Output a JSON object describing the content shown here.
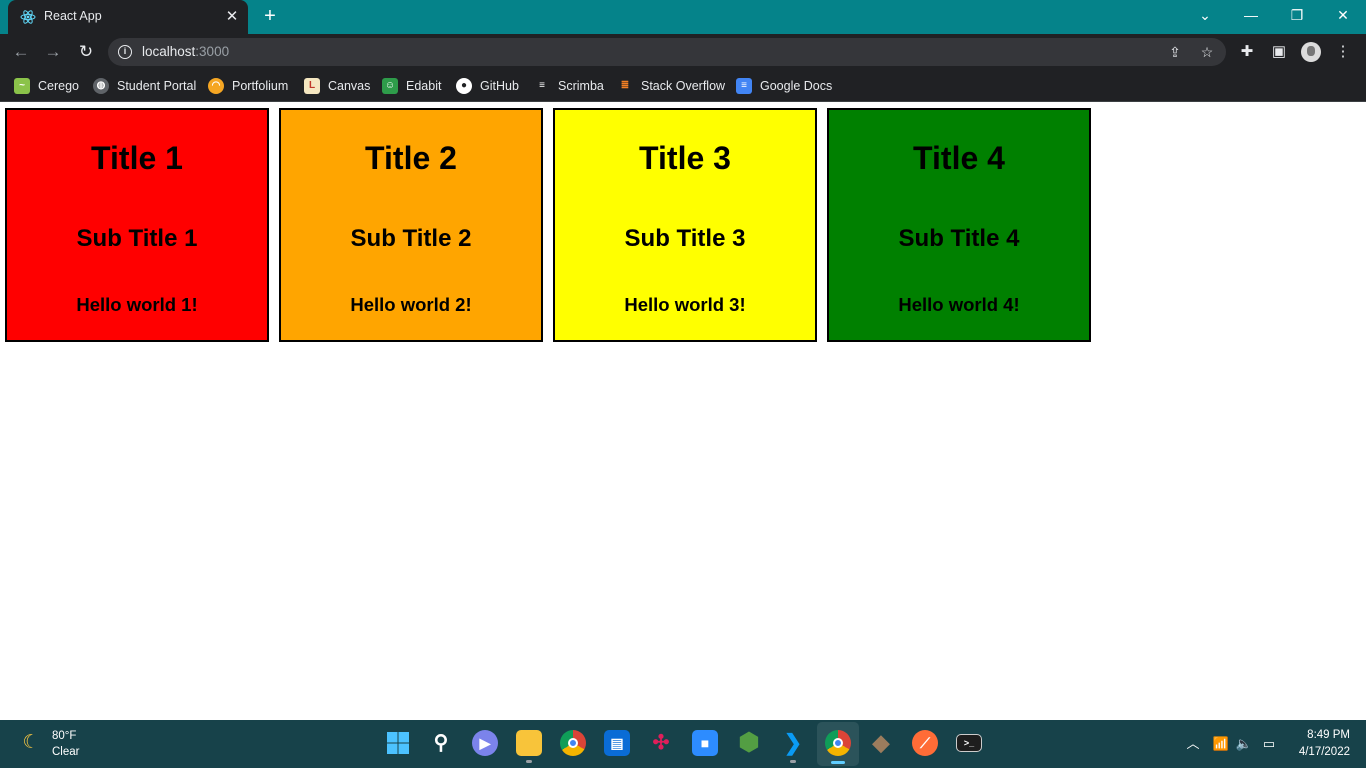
{
  "browser": {
    "tab": {
      "title": "React App",
      "favicon": "react-icon"
    },
    "url": {
      "host": "localhost",
      "port": ":3000"
    },
    "bookmarks": [
      {
        "label": "Cerego",
        "icon": "cerego-icon",
        "color": "#8bc34a"
      },
      {
        "label": "Student Portal",
        "icon": "globe-icon",
        "color": "#5f6368"
      },
      {
        "label": "Portfolium",
        "icon": "portfolium-icon",
        "color": "#f5a623"
      },
      {
        "label": "Canvas",
        "icon": "canvas-icon",
        "color": "#f5e7c1"
      },
      {
        "label": "Edabit",
        "icon": "edabit-icon",
        "color": "#2e9c4a"
      },
      {
        "label": "GitHub",
        "icon": "github-icon",
        "color": "#ffffff"
      },
      {
        "label": "Scrimba",
        "icon": "scrimba-icon",
        "color": "#ffffff"
      },
      {
        "label": "Stack Overflow",
        "icon": "stackoverflow-icon",
        "color": "#f48024"
      },
      {
        "label": "Google Docs",
        "icon": "google-docs-icon",
        "color": "#4285f4"
      }
    ]
  },
  "cards": [
    {
      "title": "Title 1",
      "subtitle": "Sub Title 1",
      "body": "Hello world 1!",
      "color": "#ff0000"
    },
    {
      "title": "Title 2",
      "subtitle": "Sub Title 2",
      "body": "Hello world 2!",
      "color": "#ffa500"
    },
    {
      "title": "Title 3",
      "subtitle": "Sub Title 3",
      "body": "Hello world 3!",
      "color": "#ffff00"
    },
    {
      "title": "Title 4",
      "subtitle": "Sub Title 4",
      "body": "Hello world 4!",
      "color": "#008000"
    }
  ],
  "taskbar": {
    "weather": {
      "temp": "80°F",
      "condition": "Clear",
      "icon": "moon-icon"
    },
    "apps": [
      {
        "name": "start-button",
        "icon": "windows-icon",
        "color": "#4cc2ff"
      },
      {
        "name": "search-button",
        "icon": "search-icon",
        "color": "transparent"
      },
      {
        "name": "teams-chat",
        "icon": "teams-icon",
        "color": "#7b83eb"
      },
      {
        "name": "file-explorer",
        "icon": "folder-icon",
        "color": "#f8c43a"
      },
      {
        "name": "chrome",
        "icon": "chrome-icon",
        "color": "#db4437"
      },
      {
        "name": "store",
        "icon": "store-icon",
        "color": "#0a6cd6"
      },
      {
        "name": "slack",
        "icon": "slack-icon",
        "color": "#ffffff"
      },
      {
        "name": "zoom",
        "icon": "zoom-icon",
        "color": "#2d8cff"
      },
      {
        "name": "nodejs",
        "icon": "nodejs-icon",
        "color": "#539e43"
      },
      {
        "name": "vscode",
        "icon": "vscode-icon",
        "color": "#0078d4"
      },
      {
        "name": "chrome-profile",
        "icon": "chrome-icon",
        "color": "#db4437"
      },
      {
        "name": "git-kraken",
        "icon": "git-icon",
        "color": "#9c7c5d"
      },
      {
        "name": "postman",
        "icon": "postman-icon",
        "color": "#ff6c37"
      },
      {
        "name": "terminal",
        "icon": "terminal-icon",
        "color": "#1e1e1e"
      }
    ],
    "clock": {
      "time": "8:49 PM",
      "date": "4/17/2022"
    }
  }
}
